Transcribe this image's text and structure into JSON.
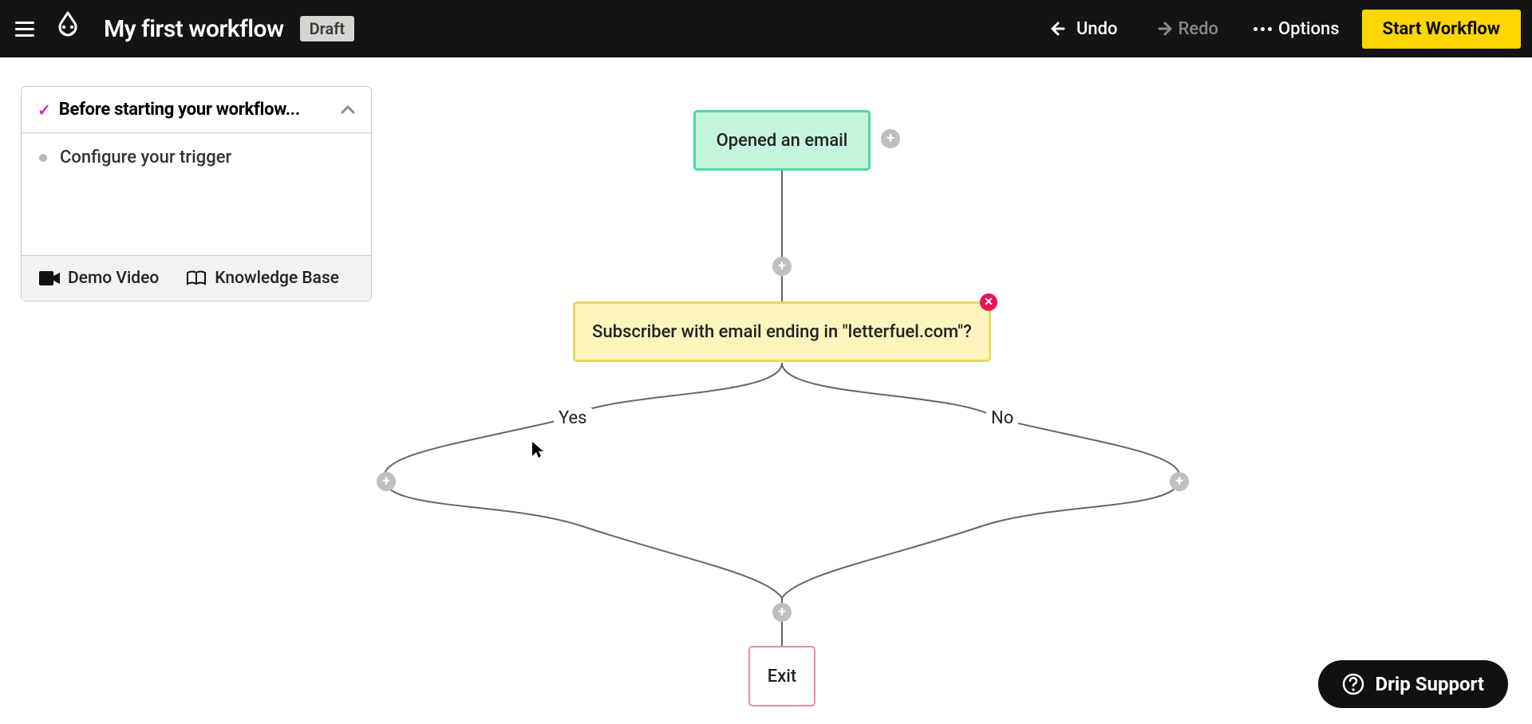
{
  "header": {
    "title": "My first workflow",
    "badge": "Draft",
    "undo": "Undo",
    "redo": "Redo",
    "options": "Options",
    "start": "Start Workflow"
  },
  "panel": {
    "title": "Before starting your workflow...",
    "task1": "Configure your trigger",
    "demo": "Demo Video",
    "kb": "Knowledge Base"
  },
  "canvas": {
    "trigger": "Opened an email",
    "decision": "Subscriber with email ending in \"letterfuel.com\"?",
    "yes": "Yes",
    "no": "No",
    "exit": "Exit"
  },
  "support": {
    "label": "Drip Support"
  }
}
